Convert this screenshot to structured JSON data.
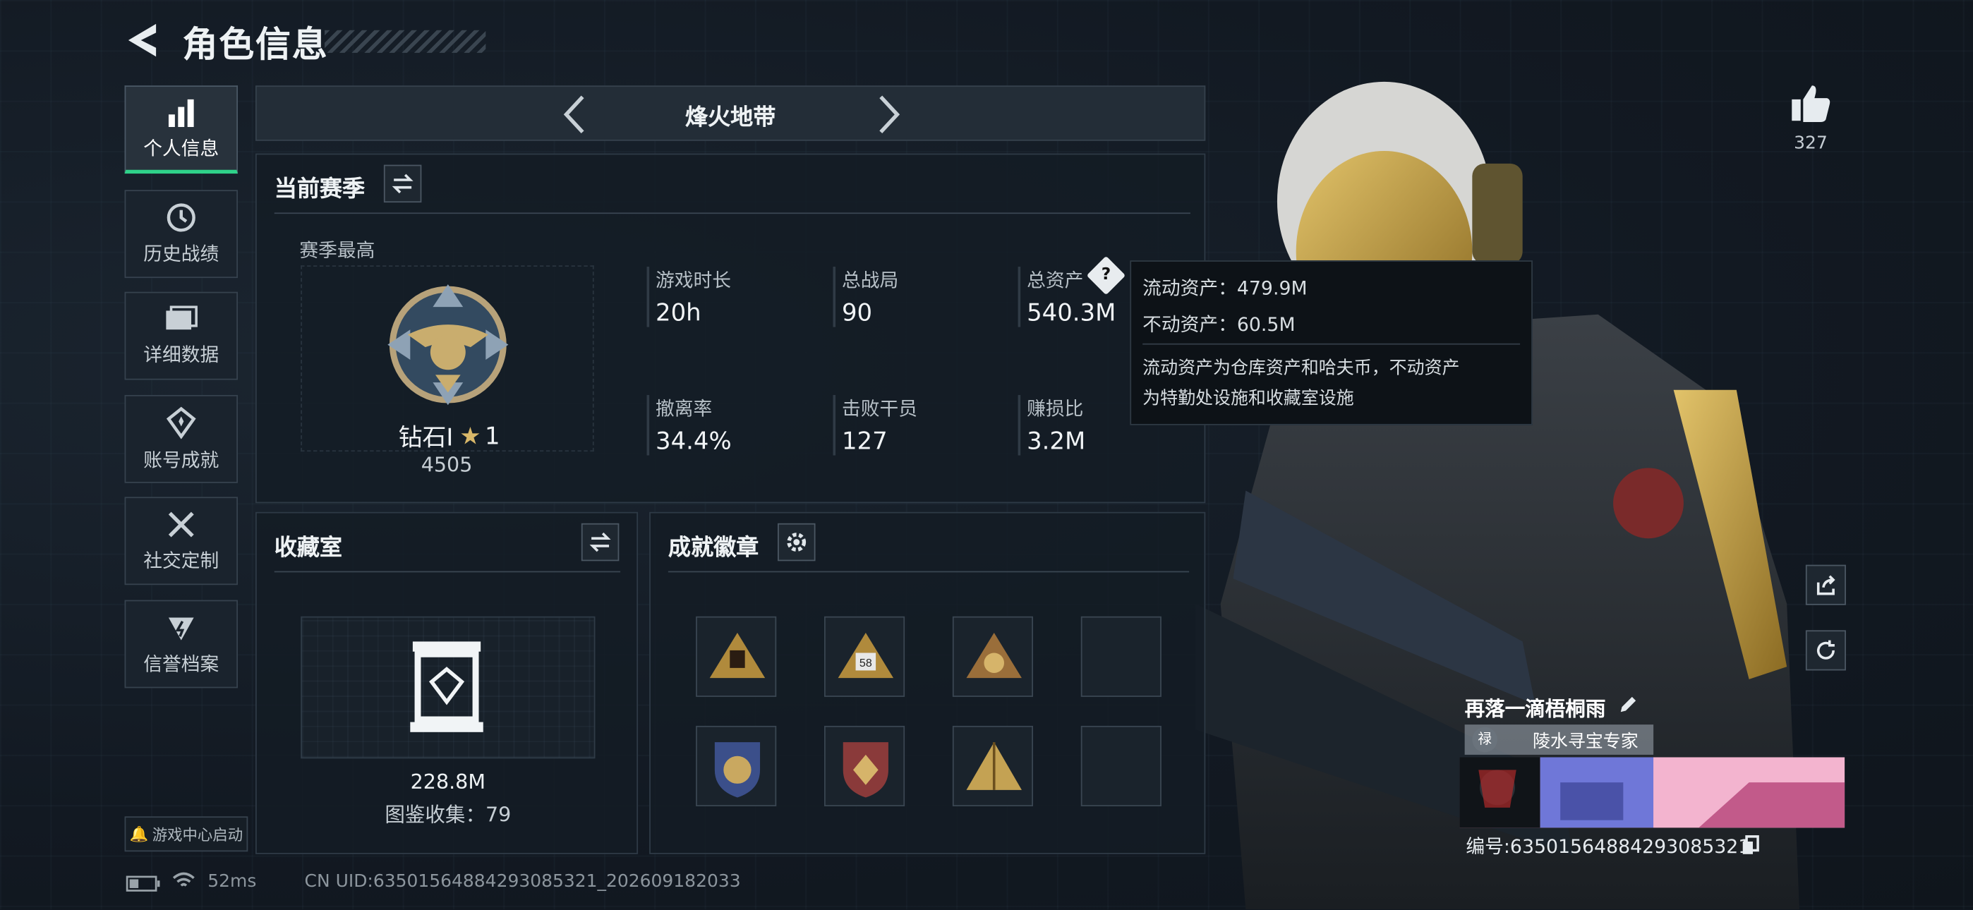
{
  "header": {
    "title": "角色信息"
  },
  "sidebar": {
    "items": [
      {
        "label": "个人信息",
        "icon": "bar-chart-icon",
        "active": true
      },
      {
        "label": "历史战绩",
        "icon": "history-icon"
      },
      {
        "label": "详细数据",
        "icon": "folder-icon"
      },
      {
        "label": "账号成就",
        "icon": "achievement-icon"
      },
      {
        "label": "社交定制",
        "icon": "tools-icon"
      },
      {
        "label": "信誉档案",
        "icon": "credit-icon"
      }
    ],
    "game_center": "游戏中心启动"
  },
  "mode": {
    "title": "烽火地带"
  },
  "season": {
    "title": "当前赛季",
    "best_label": "赛季最高",
    "rank_name": "钻石I",
    "rank_stars": "1",
    "rank_score": "4505"
  },
  "stats": [
    {
      "label": "游戏时长",
      "value": "20h"
    },
    {
      "label": "总战局",
      "value": "90"
    },
    {
      "label": "总资产",
      "value": "540.3M"
    },
    {
      "label": "撤离率",
      "value": "34.4%"
    },
    {
      "label": "击败干员",
      "value": "127"
    },
    {
      "label": "赚损比",
      "value": "3.2M"
    }
  ],
  "tooltip": {
    "line1": "流动资产：479.9M",
    "line2": "不动资产：60.5M",
    "desc1": "流动资产为仓库资产和哈夫币，不动资产",
    "desc2": "为特勤处设施和收藏室设施"
  },
  "collection": {
    "title": "收藏室",
    "value": "228.8M",
    "count_text": "图鉴收集：79"
  },
  "achievements": {
    "title": "成就徽章",
    "badges": [
      "badge-gold-triangle",
      "badge-58-triangle",
      "badge-59-triangle",
      "empty",
      "badge-shield-blue",
      "badge-shield-red",
      "badge-gold-pyramid",
      "empty"
    ]
  },
  "profile": {
    "likes": "327",
    "nickname": "再落一滴梧桐雨",
    "title_tag": "陵水寻宝专家",
    "id_text": "编号:6350156488429308532​1"
  },
  "status": {
    "ping": "52ms",
    "uid": "CN UID:6350156488429308532​1_202609182033"
  }
}
